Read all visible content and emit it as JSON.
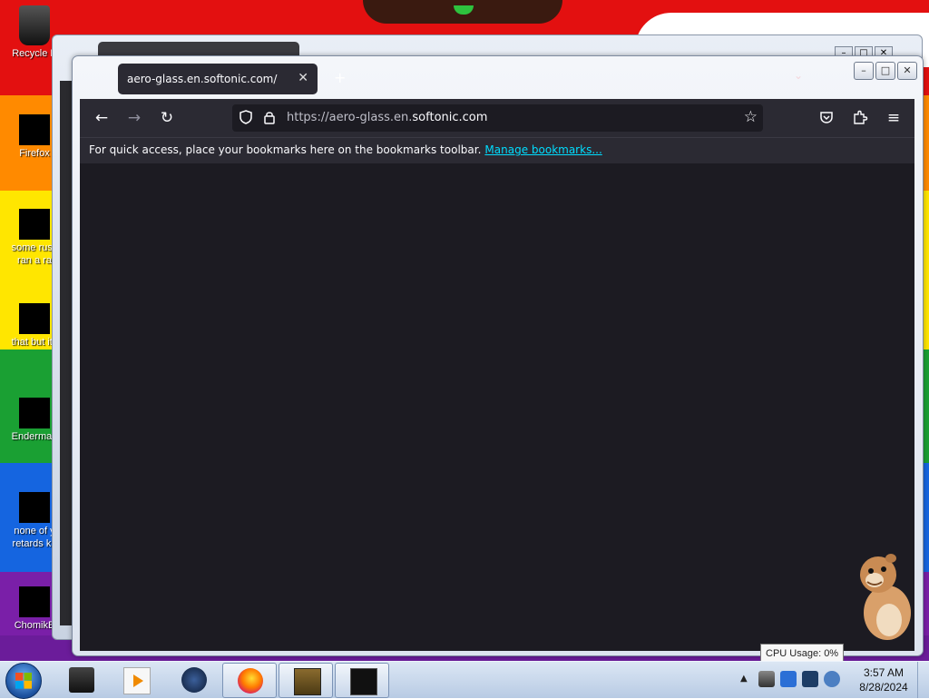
{
  "desktop": {
    "icons": [
      {
        "label": "Recycle B"
      },
      {
        "label": "Firefox"
      },
      {
        "label": "some russ",
        "label2": "ran a ra"
      },
      {
        "label": "that but its"
      },
      {
        "label": "Enderman"
      },
      {
        "label": "none of y",
        "label2": "retards kn"
      },
      {
        "label": "ChomikB"
      }
    ]
  },
  "browser": {
    "tab_title": "aero-glass.en.softonic.com/",
    "url_prefix": "https://aero-glass.en.",
    "url_domain": "softonic.com",
    "bookmarks_message": "For quick access, place your bookmarks here on the bookmarks toolbar.",
    "manage_bookmarks": "Manage bookmarks...",
    "icons": [
      "back-icon",
      "forward-icon",
      "reload-icon",
      "shield-icon",
      "lock-icon",
      "star-icon",
      "pocket-icon",
      "extensions-icon",
      "menu-icon"
    ]
  },
  "tooltip": {
    "text": "CPU Usage: 0%"
  },
  "taskbar": {
    "time": "3:57 AM",
    "date": "8/28/2024",
    "items": [
      "terminal",
      "media-player",
      "steam",
      "firefox",
      "chomik-box",
      "app-black"
    ]
  },
  "colors": {
    "accent_link": "#00ddff",
    "chrome_bg": "#2b2a33",
    "content_bg": "#1c1b22"
  }
}
